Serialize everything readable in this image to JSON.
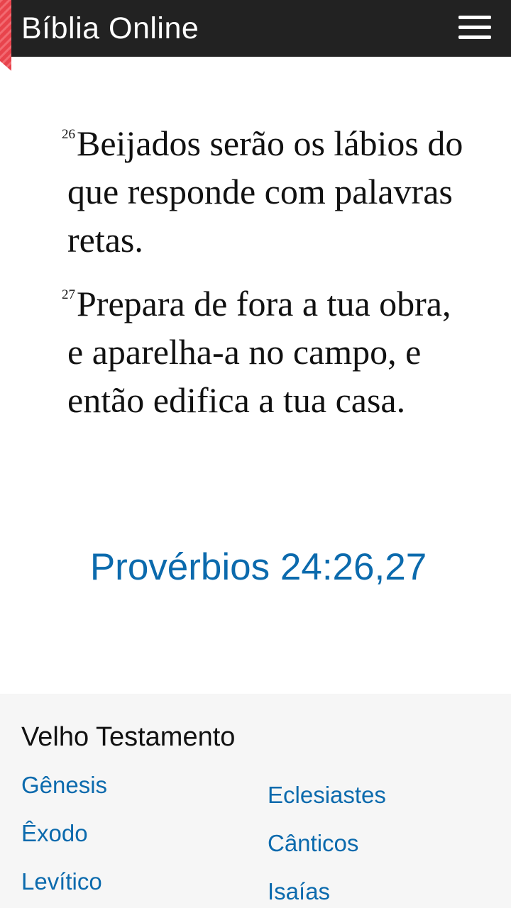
{
  "header": {
    "title": "Bíblia Online",
    "menu_icon": "hamburger-menu-icon",
    "ribbon_color": "#e8434c",
    "background": "#222222"
  },
  "passage": {
    "verses": [
      {
        "number": "26",
        "text": "Beijados serão os lábios do que responde com palavras retas."
      },
      {
        "number": "27",
        "text": "Prepara de fora a tua obra, e aparelha-a no campo, e então edifica a tua casa."
      }
    ],
    "reference": "Provérbios 24:26,27"
  },
  "footer": {
    "section_title": "Velho Testamento",
    "books_left": [
      "Gênesis",
      "Êxodo",
      "Levítico"
    ],
    "books_right": [
      "Eclesiastes",
      "Cânticos",
      "Isaías"
    ],
    "link_color": "#0b6aad"
  }
}
